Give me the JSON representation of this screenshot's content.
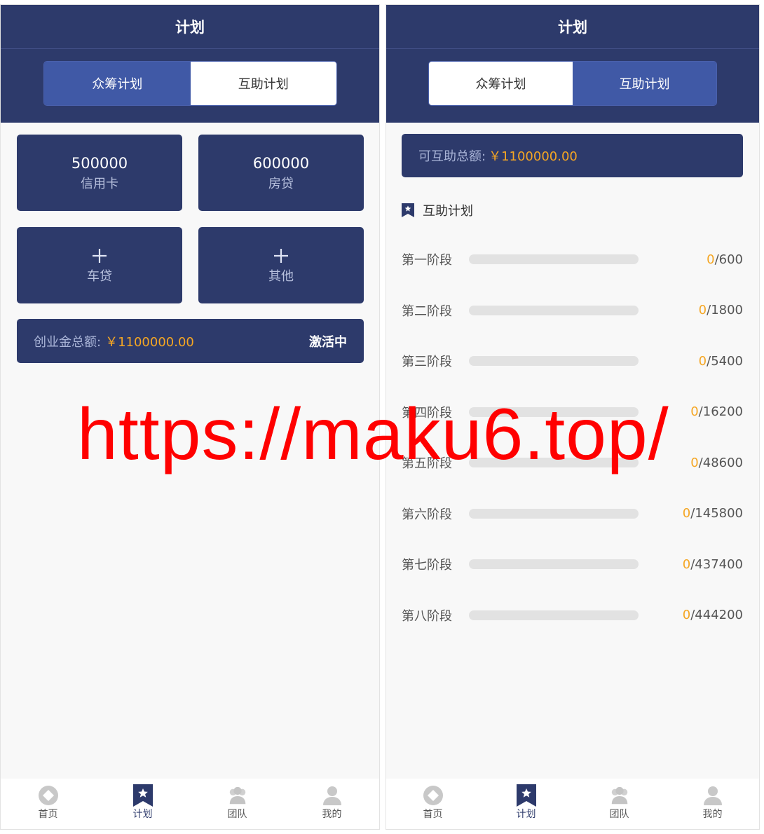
{
  "left": {
    "title": "计划",
    "tabs": [
      {
        "label": "众筹计划",
        "active": true
      },
      {
        "label": "互助计划",
        "active": false
      }
    ],
    "tiles": [
      {
        "amount": "500000",
        "label": "信用卡"
      },
      {
        "amount": "600000",
        "label": "房贷"
      },
      {
        "icon": "plus-icon",
        "label": "车贷"
      },
      {
        "icon": "plus-icon",
        "label": "其他"
      }
    ],
    "total": {
      "label": "创业金总额:",
      "value": "￥1100000.00",
      "status": "激活中"
    }
  },
  "right": {
    "title": "计划",
    "tabs": [
      {
        "label": "众筹计划",
        "active": false
      },
      {
        "label": "互助计划",
        "active": true
      }
    ],
    "total": {
      "label": "可互助总额:",
      "value": "￥1100000.00"
    },
    "section_title": "互助计划",
    "section_icon": "bookmark-star-icon",
    "stages": [
      {
        "name": "第一阶段",
        "done": "0",
        "total": "/600",
        "progress": 0
      },
      {
        "name": "第二阶段",
        "done": "0",
        "total": "/1800",
        "progress": 0
      },
      {
        "name": "第三阶段",
        "done": "0",
        "total": "/5400",
        "progress": 0
      },
      {
        "name": "第四阶段",
        "done": "0",
        "total": "/16200",
        "progress": 0
      },
      {
        "name": "第五阶段",
        "done": "0",
        "total": "/48600",
        "progress": 0
      },
      {
        "name": "第六阶段",
        "done": "0",
        "total": "/145800",
        "progress": 0
      },
      {
        "name": "第七阶段",
        "done": "0",
        "total": "/437400",
        "progress": 0
      },
      {
        "name": "第八阶段",
        "done": "0",
        "total": "/444200",
        "progress": 0
      }
    ]
  },
  "tabbar": [
    {
      "label": "首页",
      "icon": "home-icon",
      "active": false
    },
    {
      "label": "计划",
      "icon": "plan-bookmark-icon",
      "active": true
    },
    {
      "label": "团队",
      "icon": "team-icon",
      "active": false
    },
    {
      "label": "我的",
      "icon": "user-icon",
      "active": false
    }
  ],
  "watermark": "https://maku6.top/",
  "colors": {
    "header": "#2d3a6b",
    "active_tab": "#4059a6",
    "accent": "#f5a623",
    "background": "#f8f8f8"
  }
}
